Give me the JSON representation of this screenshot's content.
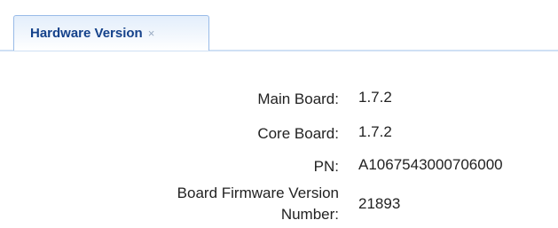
{
  "tab": {
    "label": "Hardware Version",
    "close_symbol": "×"
  },
  "fields": [
    {
      "label": "Main Board:",
      "value": "1.7.2"
    },
    {
      "label": "Core Board:",
      "value": "1.7.2"
    },
    {
      "label": "PN:",
      "value": "A1067543000706000"
    },
    {
      "label_line1": "Board Firmware Version",
      "label_line2": "Number:",
      "value": "21893"
    }
  ],
  "colors": {
    "tab_text": "#15428b",
    "tab_border": "#99bbe8",
    "text": "#222222"
  }
}
